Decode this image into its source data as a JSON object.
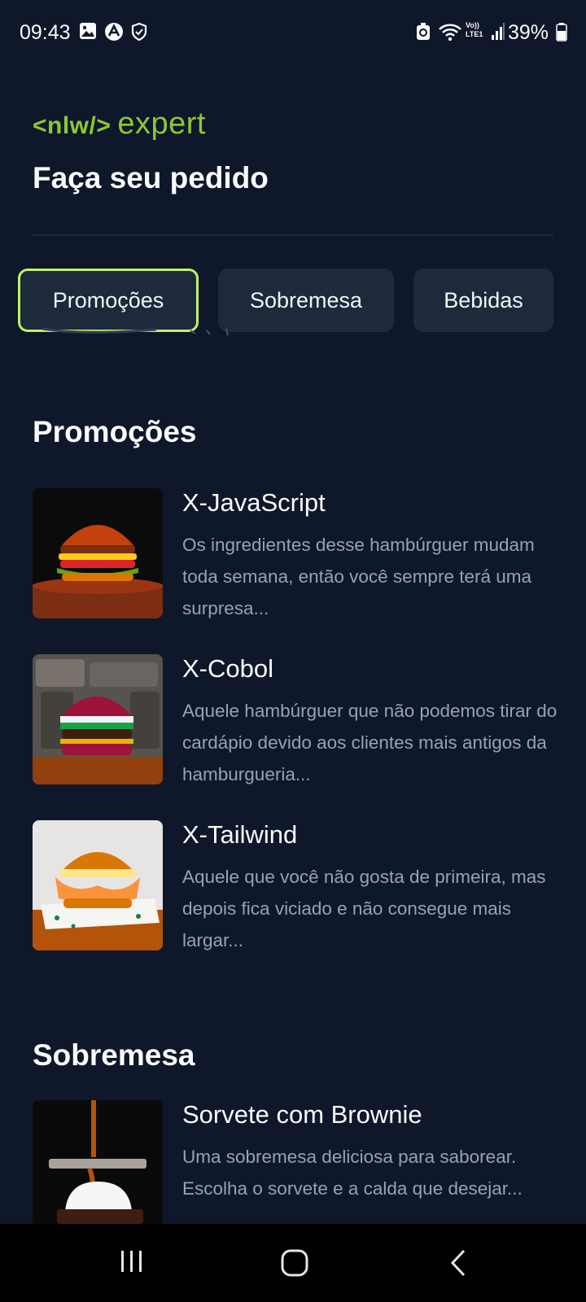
{
  "status_bar": {
    "time": "09:43",
    "battery": "39%",
    "icons_left": [
      "gallery-icon",
      "app-icon",
      "shield-icon"
    ],
    "icons_right": [
      "recycle-icon",
      "wifi-icon",
      "volte-icon",
      "signal-icon",
      "battery-icon"
    ],
    "volte_label": "Vo)) LTE1"
  },
  "header": {
    "logo_nlw": "<nlw/>",
    "logo_expert": "expert",
    "title": "Faça seu pedido"
  },
  "tabs": [
    {
      "label": "Promoções",
      "active": true
    },
    {
      "label": "Sobremesa",
      "active": false
    },
    {
      "label": "Bebidas",
      "active": false
    }
  ],
  "sections": [
    {
      "title": "Promoções",
      "items": [
        {
          "name": "X-JavaScript",
          "description": "Os ingredientes desse hambúrguer mudam toda semana, então você sempre terá uma surpresa..."
        },
        {
          "name": "X-Cobol",
          "description": "Aquele hambúrguer que não podemos tirar do cardápio devido aos clientes mais antigos da hamburgueria..."
        },
        {
          "name": "X-Tailwind",
          "description": "Aquele que você não gosta de primeira, mas depois fica viciado e não consegue mais largar..."
        }
      ]
    },
    {
      "title": "Sobremesa",
      "items": [
        {
          "name": "Sorvete com Brownie",
          "description": "Uma sobremesa deliciosa para saborear. Escolha o sorvete e a calda que desejar..."
        }
      ]
    }
  ],
  "nav_bar": {
    "icons": [
      "recent-apps-icon",
      "home-icon",
      "back-icon"
    ]
  },
  "colors": {
    "background": "#0f172a",
    "surface": "#1e293b",
    "accent": "#bef264",
    "muted_text": "#94a3b8"
  }
}
